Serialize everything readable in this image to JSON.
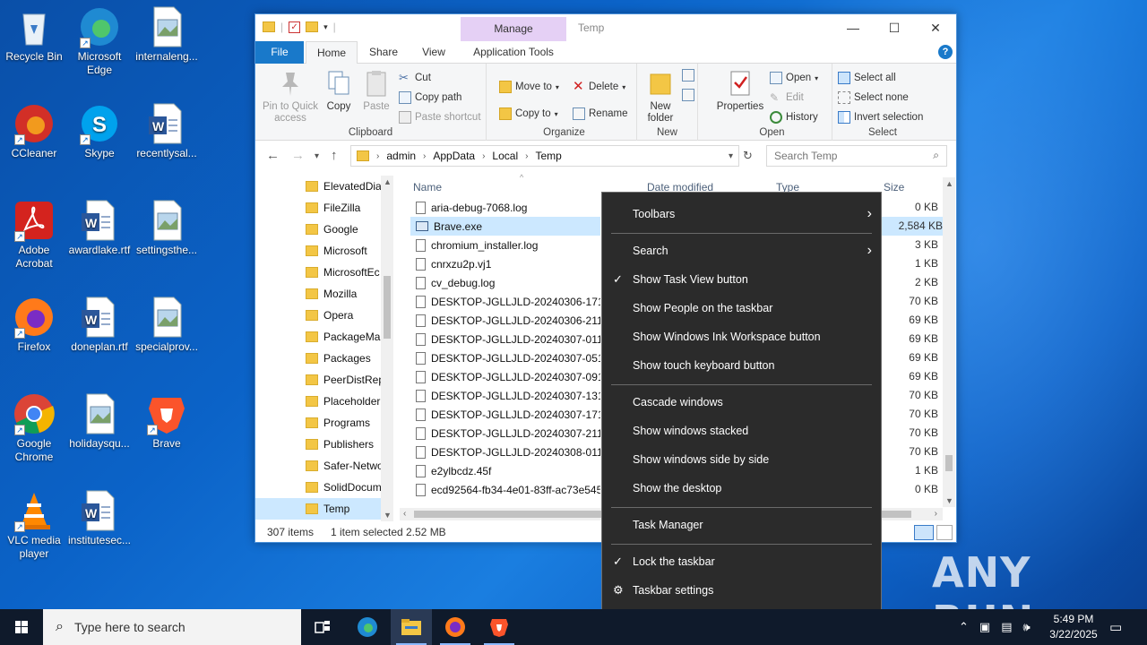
{
  "desktop": {
    "icons": [
      {
        "label": "Recycle Bin",
        "icon": "recycle-bin-icon"
      },
      {
        "label": "Microsoft Edge",
        "icon": "edge-icon"
      },
      {
        "label": "internaleng...",
        "icon": "image-file-icon"
      },
      {
        "label": "CCleaner",
        "icon": "ccleaner-icon"
      },
      {
        "label": "Skype",
        "icon": "skype-icon"
      },
      {
        "label": "recentlysal...",
        "icon": "word-doc-icon"
      },
      {
        "label": "Adobe Acrobat",
        "icon": "acrobat-icon"
      },
      {
        "label": "awardlake.rtf",
        "icon": "word-doc-icon"
      },
      {
        "label": "settingsthe...",
        "icon": "image-file-icon"
      },
      {
        "label": "Firefox",
        "icon": "firefox-icon"
      },
      {
        "label": "doneplan.rtf",
        "icon": "word-doc-icon"
      },
      {
        "label": "specialprov...",
        "icon": "image-file-icon"
      },
      {
        "label": "Google Chrome",
        "icon": "chrome-icon"
      },
      {
        "label": "holidaysqu...",
        "icon": "image-file-icon"
      },
      {
        "label": "Brave",
        "icon": "brave-icon"
      },
      {
        "label": "VLC media player",
        "icon": "vlc-icon"
      },
      {
        "label": "institutesec...",
        "icon": "word-doc-icon"
      }
    ]
  },
  "explorer": {
    "title": "Temp",
    "manage_tab": "Manage",
    "tabs": [
      "File",
      "Home",
      "Share",
      "View",
      "Application Tools"
    ],
    "help": "?",
    "ribbon": {
      "clipboard": {
        "label": "Clipboard",
        "pin": "Pin to Quick access",
        "copy": "Copy",
        "paste": "Paste",
        "cut": "Cut",
        "copy_path": "Copy path",
        "paste_shortcut": "Paste shortcut"
      },
      "organize": {
        "label": "Organize",
        "move_to": "Move to",
        "copy_to": "Copy to",
        "delete": "Delete",
        "rename": "Rename"
      },
      "new": {
        "label": "New",
        "new_folder": "New folder"
      },
      "open": {
        "label": "Open",
        "properties": "Properties",
        "open": "Open",
        "edit": "Edit",
        "history": "History"
      },
      "select": {
        "label": "Select",
        "select_all": "Select all",
        "select_none": "Select none",
        "invert": "Invert selection"
      }
    },
    "address": {
      "crumbs": [
        "admin",
        "AppData",
        "Local",
        "Temp"
      ],
      "search_placeholder": "Search Temp"
    },
    "nav_items": [
      "ElevatedDia",
      "FileZilla",
      "Google",
      "Microsoft",
      "MicrosoftEc",
      "Mozilla",
      "Opera",
      "PackageMa",
      "Packages",
      "PeerDistRep",
      "Placeholder",
      "Programs",
      "Publishers",
      "Safer-Netwo",
      "SolidDocum",
      "Temp"
    ],
    "columns": {
      "name": "Name",
      "date": "Date modified",
      "type": "Type",
      "size": "Size"
    },
    "files": [
      {
        "name": "aria-debug-7068.log",
        "size": "0 KB"
      },
      {
        "name": "Brave.exe",
        "size": "2,584 KB"
      },
      {
        "name": "chromium_installer.log",
        "size": "3 KB"
      },
      {
        "name": "cnrxzu2p.vj1",
        "size": "1 KB"
      },
      {
        "name": "cv_debug.log",
        "size": "2 KB"
      },
      {
        "name": "DESKTOP-JGLLJLD-20240306-1710.lo",
        "size": "70 KB"
      },
      {
        "name": "DESKTOP-JGLLJLD-20240306-2110.lo",
        "size": "69 KB"
      },
      {
        "name": "DESKTOP-JGLLJLD-20240307-0110.lo",
        "size": "69 KB"
      },
      {
        "name": "DESKTOP-JGLLJLD-20240307-0510.lo",
        "size": "69 KB"
      },
      {
        "name": "DESKTOP-JGLLJLD-20240307-0910.lo",
        "size": "69 KB"
      },
      {
        "name": "DESKTOP-JGLLJLD-20240307-1310.lo",
        "size": "70 KB"
      },
      {
        "name": "DESKTOP-JGLLJLD-20240307-1710.lo",
        "size": "70 KB"
      },
      {
        "name": "DESKTOP-JGLLJLD-20240307-2110.lo",
        "size": "70 KB"
      },
      {
        "name": "DESKTOP-JGLLJLD-20240308-0110.lo",
        "size": "70 KB"
      },
      {
        "name": "e2ylbcdz.45f",
        "size": "1 KB"
      },
      {
        "name": "ecd92564-fb34-4e01-83ff-ac73e5451",
        "size": "0 KB"
      }
    ],
    "status": {
      "count": "307 items",
      "selected": "1 item selected",
      "size": "2.52 MB"
    }
  },
  "context_menu": {
    "items": [
      {
        "label": "Toolbars",
        "submenu": true
      },
      {
        "label": "Search",
        "submenu": true
      },
      {
        "label": "Show Task View button",
        "checked": true
      },
      {
        "label": "Show People on the taskbar"
      },
      {
        "label": "Show Windows Ink Workspace button"
      },
      {
        "label": "Show touch keyboard button"
      },
      {
        "label": "Cascade windows"
      },
      {
        "label": "Show windows stacked"
      },
      {
        "label": "Show windows side by side"
      },
      {
        "label": "Show the desktop"
      },
      {
        "label": "Task Manager"
      },
      {
        "label": "Lock the taskbar",
        "checked": true
      },
      {
        "label": "Taskbar settings",
        "icon": "gear-icon"
      }
    ]
  },
  "watermark": "ANY RUN",
  "taskbar": {
    "search_placeholder": "Type here to search",
    "time": "5:49 PM",
    "date": "3/22/2025"
  }
}
